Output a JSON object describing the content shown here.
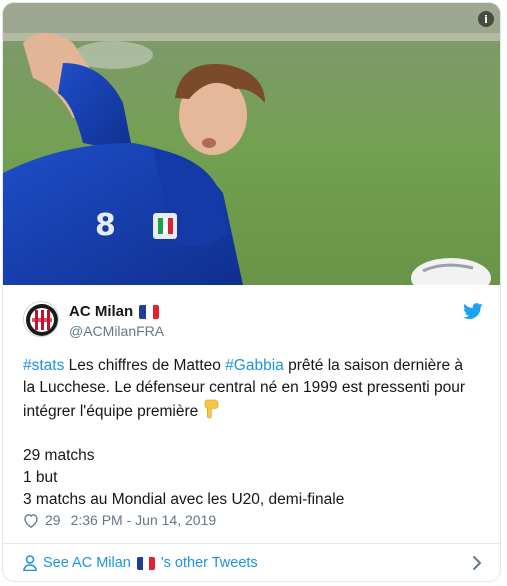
{
  "media": {
    "image_alt": "Photo of a football player in a blue Italy jersey with number 8, lying on a grass pitch",
    "info_icon": "info-icon",
    "jersey_number": "8"
  },
  "author": {
    "name": "AC Milan",
    "handle": "@ACMilanFRA",
    "flag_icon": "france-flag-icon",
    "avatar_icon": "ac-milan-logo"
  },
  "tweet": {
    "line1_hashtag1": "#stats",
    "line1_text1": " Les chiffres de Matteo ",
    "line1_hashtag2": "#Gabbia",
    "line1_text2": " prêté la saison dernière à",
    "line2": "la Lucchese. Le défenseur central né en 1999 est pressenti pour",
    "line3": "intégrer l'équipe première ",
    "stat1": "29 matchs",
    "stat2": "1 but",
    "stat3": "3 matchs au Mondial avec les U20, demi-finale"
  },
  "meta": {
    "likes": "29",
    "timestamp": "2:36 PM - Jun 14, 2019"
  },
  "footer": {
    "see_prefix": "See AC Milan ",
    "see_suffix": "'s other Tweets"
  },
  "colors": {
    "link": "#1b95e0",
    "secondary": "#657786",
    "border": "#e1e8ed"
  }
}
